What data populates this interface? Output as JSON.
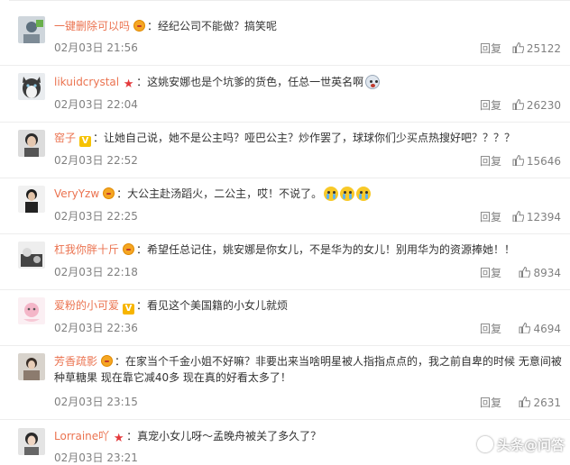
{
  "comments": [
    {
      "user": "一键删除可以吗",
      "text": "经纪公司不能做？搞笑呢",
      "time": "02月03日 21:56",
      "reply": "回复",
      "likes": "25122"
    },
    {
      "user": "likuidcrystal",
      "text": "这姚安娜也是个坑爹的货色，任总一世英名啊",
      "time": "02月03日 22:04",
      "reply": "回复",
      "likes": "26230"
    },
    {
      "user": "窑子",
      "text": "让她自己说，她不是公主吗？哑巴公主？炒作罢了，球球你们少买点热搜好吧？？？？",
      "time": "02月03日 22:52",
      "reply": "回复",
      "likes": "15646"
    },
    {
      "user": "VeryYzw",
      "text": "大公主赴汤蹈火，二公主，哎！不说了。",
      "time": "02月03日 22:25",
      "reply": "回复",
      "likes": "12394"
    },
    {
      "user": "杠我你胖十斤",
      "text": "希望任总记住，姚安娜是你女儿，不是华为的女儿！别用华为的资源捧她！！",
      "time": "02月03日 22:18",
      "reply": "回复",
      "likes": "8934"
    },
    {
      "user": "爱粉的小可爱",
      "text": "看见这个美国籍的小女儿就烦",
      "time": "02月03日 22:36",
      "reply": "回复",
      "likes": "4694"
    },
    {
      "user": "芳香疏影",
      "text": "在家当个千金小姐不好嘛？非要出来当啥明星被人指指点点的，我之前自卑的时候 无意间被种草糖果 现在靠它减40多 现在真的好看太多了！",
      "time": "02月03日 23:15",
      "reply": "回复",
      "likes": "2631"
    },
    {
      "user": "Lorraine吖",
      "text": "真宠小女儿呀～孟晚舟被关了多久了？",
      "time": "02月03日 23:21",
      "reply": "回复",
      "likes": ""
    }
  ],
  "watermark": "头条@问答",
  "colors": {
    "username": "#eb7350",
    "meta": "#808080",
    "divider": "#ededed"
  }
}
